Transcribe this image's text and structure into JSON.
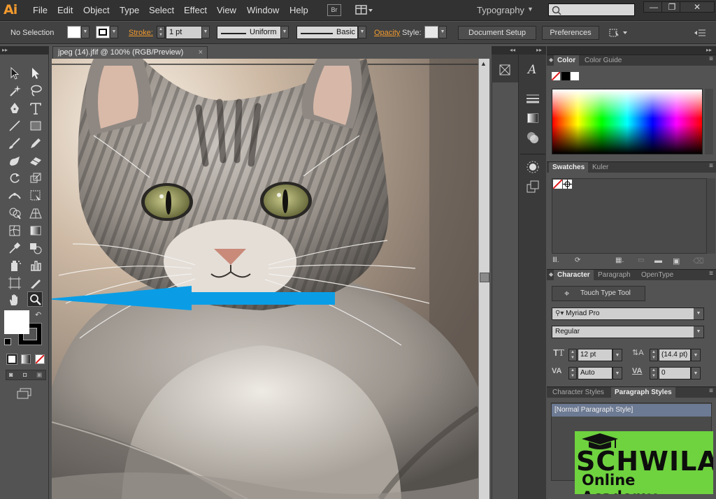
{
  "app": {
    "logo_text": "Ai",
    "bridge_label": "Br",
    "workspace": "Typography"
  },
  "menu": [
    "File",
    "Edit",
    "Object",
    "Type",
    "Select",
    "Effect",
    "View",
    "Window",
    "Help"
  ],
  "window_controls": {
    "minimize": "—",
    "restore": "❐",
    "close": "✕"
  },
  "control_bar": {
    "selection_status": "No Selection",
    "stroke_label": "Stroke:",
    "stroke_weight": "1 pt",
    "variable_width_profile": "Uniform",
    "brush_definition": "Basic",
    "opacity_label": "Opacity",
    "style_label": "Style:",
    "document_setup_button": "Document Setup",
    "preferences_button": "Preferences",
    "fill_color": "#ffffff",
    "stroke_color": "#000000"
  },
  "document": {
    "tab_title": "jpeg (14).jfif @ 100% (RGB/Preview)",
    "close_glyph": "×",
    "annotation_arrow_color": "#0a9de6"
  },
  "panels": {
    "color": {
      "tabs": [
        "Color",
        "Color Guide"
      ]
    },
    "swatches": {
      "tabs": [
        "Swatches",
        "Kuler"
      ]
    },
    "character": {
      "tabs": [
        "Character",
        "Paragraph",
        "OpenType"
      ],
      "touch_type_button": "Touch Type Tool",
      "font_family": "Myriad Pro",
      "font_style": "Regular",
      "font_size": "12 pt",
      "leading": "(14.4 pt)",
      "kerning": "Auto",
      "tracking": "0"
    },
    "styles": {
      "tabs": [
        "Character Styles",
        "Paragraph Styles"
      ],
      "items": [
        "[Normal Paragraph Style]"
      ]
    }
  },
  "watermark": {
    "line1": "SCHWILA",
    "line2": "Online Academy"
  }
}
